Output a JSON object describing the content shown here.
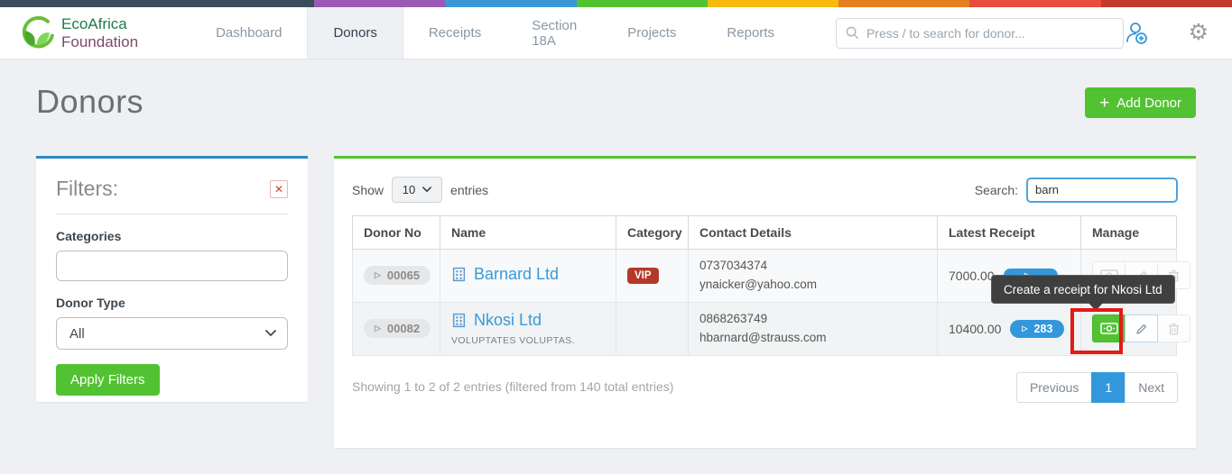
{
  "brand": {
    "line1": "EcoAfrica",
    "line2": "Foundation"
  },
  "nav": {
    "items": [
      "Dashboard",
      "Donors",
      "Receipts",
      "Section 18A",
      "Projects",
      "Reports"
    ],
    "active_item": "Donors",
    "search_placeholder": "Press / to search for donor..."
  },
  "page": {
    "title": "Donors",
    "add_donor_label": "Add Donor",
    "add_donor_plus": "+"
  },
  "filters": {
    "title": "Filters:",
    "close_glyph": "✕",
    "categories_label": "Categories",
    "categories_value": "",
    "donor_type_label": "Donor Type",
    "donor_type_value": "All",
    "apply_label": "Apply Filters"
  },
  "table": {
    "show_label": "Show",
    "page_length": "10",
    "entries_label": "entries",
    "search_label": "Search:",
    "search_value": "barn",
    "columns": [
      "Donor No",
      "Name",
      "Category",
      "Contact Details",
      "Latest Receipt",
      "Manage"
    ],
    "rows": [
      {
        "donor_no": "00065",
        "caret": "▷",
        "name": "Barnard Ltd",
        "subtitle": "",
        "category": "VIP",
        "phone": "0737034374",
        "email": "ynaicker@yahoo.com",
        "amount": "7000.00",
        "receipt_count": ""
      },
      {
        "donor_no": "00082",
        "caret": "▷",
        "name": "Nkosi Ltd",
        "subtitle": "VOLUPTATES VOLUPTAS.",
        "category": "",
        "phone": "0868263749",
        "email": "hbarnard@strauss.com",
        "amount": "10400.00",
        "receipt_count": "283"
      }
    ],
    "summary": "Showing 1 to 2 of 2 entries (filtered from 140 total entries)",
    "pagination": {
      "previous": "Previous",
      "page": "1",
      "next": "Next"
    }
  },
  "tooltip": {
    "text": "Create a receipt for Nkosi Ltd"
  },
  "colors": {
    "accent_green": "#52c232",
    "accent_blue": "#3298db",
    "filters_border_blue": "#2e86c1",
    "vip_red": "#b5392a",
    "annotation_red": "#e41b12",
    "strip": [
      "#3b4d5c",
      "#9b59b6",
      "#3a96d5",
      "#52c232",
      "#f5b90f",
      "#e67e22",
      "#e74c3c",
      "#c0392b"
    ]
  }
}
